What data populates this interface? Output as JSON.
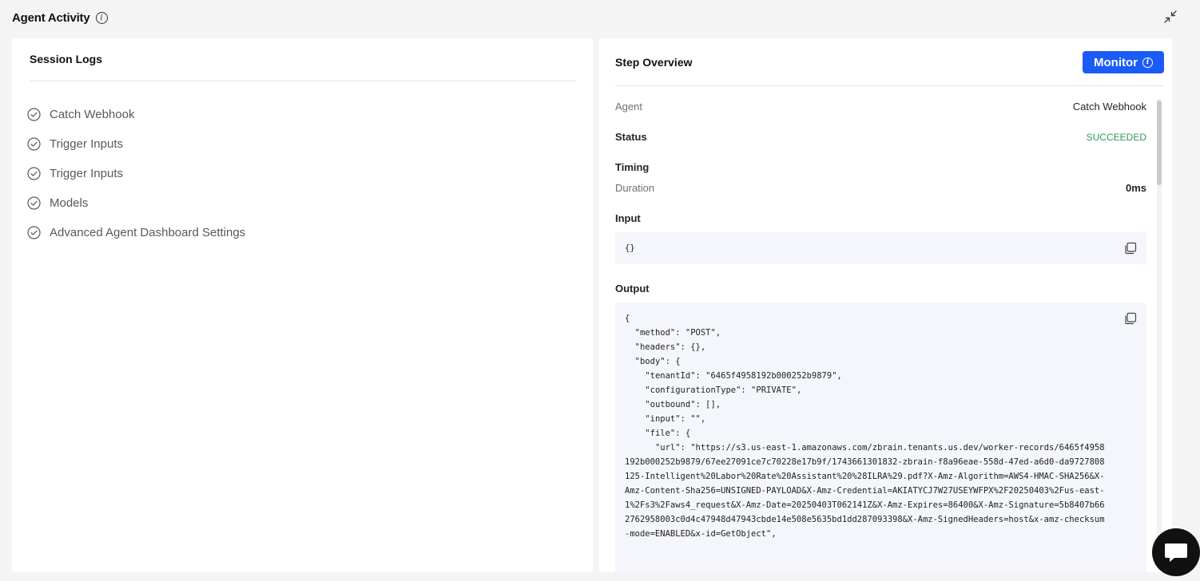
{
  "header": {
    "title": "Agent Activity"
  },
  "session_logs": {
    "title": "Session Logs",
    "items": [
      {
        "label": "Catch Webhook"
      },
      {
        "label": "Trigger Inputs"
      },
      {
        "label": "Trigger Inputs"
      },
      {
        "label": "Models"
      },
      {
        "label": "Advanced Agent Dashboard Settings"
      }
    ]
  },
  "step_overview": {
    "title": "Step Overview",
    "monitor_label": "Monitor",
    "agent_label": "Agent",
    "agent_value": "Catch Webhook",
    "status_label": "Status",
    "status_value": "SUCCEEDED",
    "timing_label": "Timing",
    "duration_label": "Duration",
    "duration_value": "0ms",
    "input_label": "Input",
    "input_value": "{}",
    "output_label": "Output",
    "output_value": "{\n  \"method\": \"POST\",\n  \"headers\": {},\n  \"body\": {\n    \"tenantId\": \"6465f4958192b000252b9879\",\n    \"configurationType\": \"PRIVATE\",\n    \"outbound\": [],\n    \"input\": \"\",\n    \"file\": {\n      \"url\": \"https://s3.us-east-1.amazonaws.com/zbrain.tenants.us.dev/worker-records/6465f4958192b000252b9879/67ee27091ce7c70228e17b9f/1743661301832-zbrain-f8a96eae-558d-47ed-a6d0-da9727808125-Intelligent%20Labor%20Rate%20Assistant%20%28ILRA%29.pdf?X-Amz-Algorithm=AWS4-HMAC-SHA256&X-Amz-Content-Sha256=UNSIGNED-PAYLOAD&X-Amz-Credential=AKIATYCJ7W27USEYWFPX%2F20250403%2Fus-east-1%2Fs3%2Faws4_request&X-Amz-Date=20250403T062141Z&X-Amz-Expires=86400&X-Amz-Signature=5b8407b662762958003c0d4c47948d47943cbde14e508e5635bd1dd287093398&X-Amz-SignedHeaders=host&x-amz-checksum-mode=ENABLED&x-id=GetObject\","
  },
  "colors": {
    "accent": "#1a5cf5",
    "success": "#2e9a5b",
    "code_bg": "#f4f6fb",
    "page_bg": "#f4f4f5"
  },
  "icons": {
    "info": "info-icon",
    "collapse": "collapse-icon",
    "check": "check-circle-icon",
    "copy": "copy-icon",
    "chat": "chat-icon"
  }
}
